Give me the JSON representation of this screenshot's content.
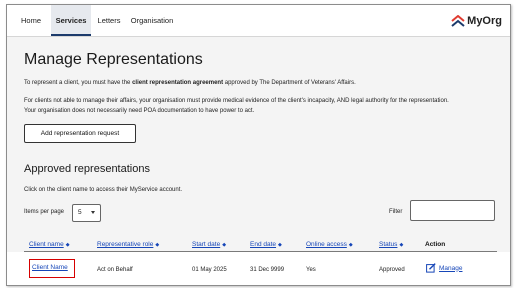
{
  "nav": {
    "tabs": [
      {
        "label": "Home"
      },
      {
        "label": "Services"
      },
      {
        "label": "Letters"
      },
      {
        "label": "Organisation"
      }
    ],
    "active_tab": "Services",
    "logo_text": "MyOrg"
  },
  "page": {
    "title": "Manage Representations",
    "intro_prefix": "To represent a client, you must have the ",
    "intro_bold": "client representation agreement",
    "intro_suffix": " approved by The Department of Veterans' Affairs.",
    "poa_line1": "For clients not able to manage their affairs, your organisation must provide medical evidence of the client's incapacity, AND legal authority for the representation.",
    "poa_line2": "Your organisation does not necessarily need POA documentation to have power to act.",
    "add_button": "Add representation request"
  },
  "approved": {
    "title": "Approved representations",
    "help_text": "Click on the client name to access their MyService account.",
    "items_per_page_label": "Items per page",
    "items_per_page_value": "5",
    "filter_label": "Filter",
    "columns": [
      "Client name",
      "Representative role",
      "Start date",
      "End date",
      "Online access",
      "Status",
      "Action"
    ],
    "rows": [
      {
        "client_name": "Client Name",
        "representative_role": "Act on Behalf",
        "start_date": "01 May 2025",
        "end_date": "31 Dec 9999",
        "online_access": "Yes",
        "status": "Approved",
        "action": "Manage"
      }
    ]
  },
  "colors": {
    "accent_link": "#1646b8",
    "highlight_border": "#d60000",
    "logo_red": "#e03c31",
    "logo_blue": "#1b3a6b"
  }
}
